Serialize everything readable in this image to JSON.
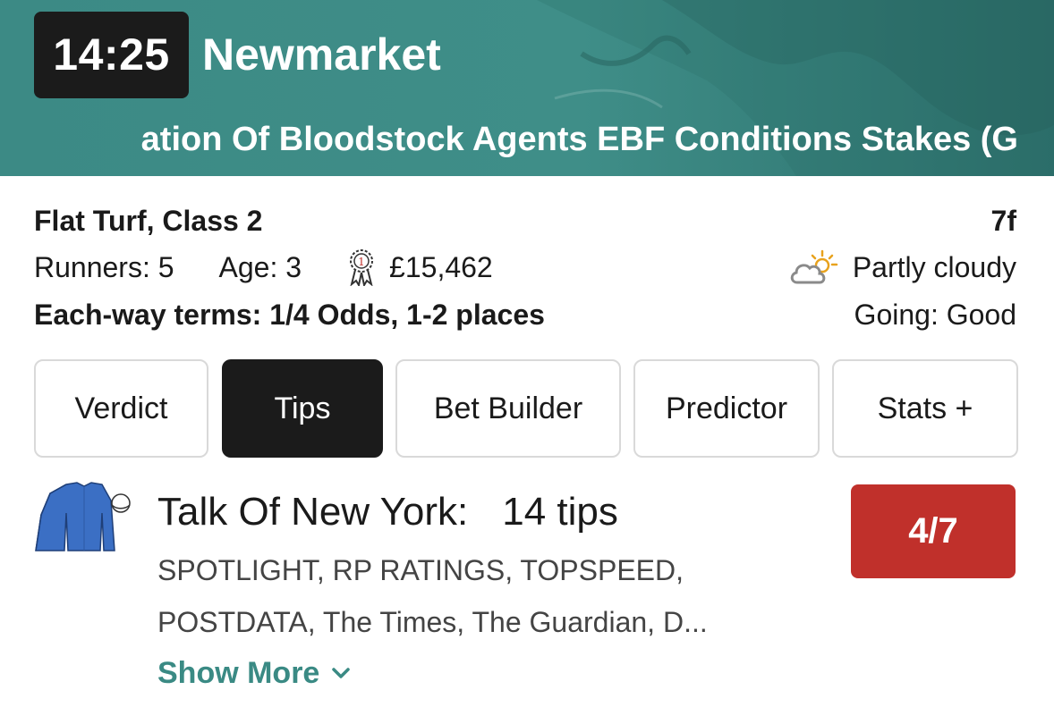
{
  "header": {
    "time": "14:25",
    "venue": "Newmarket",
    "race_name": "ation Of Bloodstock Agents EBF Conditions Stakes (G"
  },
  "race_info": {
    "type_class": "Flat Turf, Class 2",
    "distance": "7f",
    "runners": "Runners: 5",
    "age": "Age: 3",
    "prize": "£15,462",
    "weather": "Partly cloudy",
    "each_way": "Each-way terms: 1/4 Odds, 1-2 places",
    "going": "Going: Good"
  },
  "tabs": [
    {
      "label": "Verdict",
      "active": false
    },
    {
      "label": "Tips",
      "active": true
    },
    {
      "label": "Bet Builder",
      "active": false
    },
    {
      "label": "Predictor",
      "active": false
    },
    {
      "label": "Stats +",
      "active": false
    }
  ],
  "tip": {
    "horse": "Talk Of New York:",
    "tips_count": "14 tips",
    "odds": "4/7",
    "sources_line1": "SPOTLIGHT, RP RATINGS, TOPSPEED,",
    "sources_line2": "POSTDATA, The Times, The Guardian, D...",
    "show_more": "Show More",
    "silks_color": "#3b6fc4"
  },
  "colors": {
    "header_bg": "#3f8e88",
    "accent": "#3a8a84",
    "odds_bg": "#c0302b",
    "active_tab": "#1b1b1b"
  }
}
